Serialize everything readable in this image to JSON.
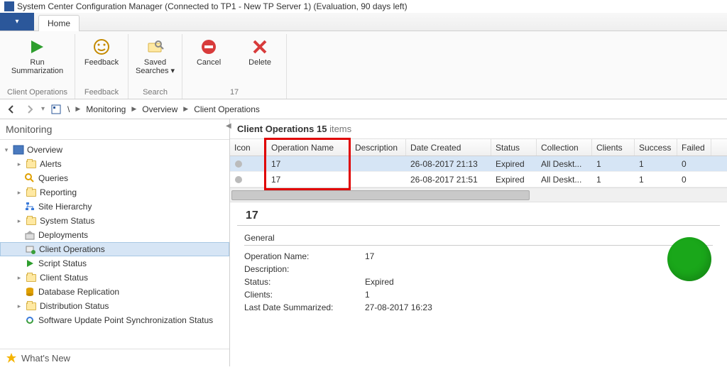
{
  "window": {
    "title": "System Center Configuration Manager (Connected to TP1 - New TP Server 1) (Evaluation, 90 days left)"
  },
  "tab": {
    "home": "Home"
  },
  "ribbon": {
    "run_summarization": "Run\nSummarization",
    "feedback": "Feedback",
    "saved_searches": "Saved\nSearches",
    "cancel": "Cancel",
    "delete": "Delete",
    "group_client_ops": "Client Operations",
    "group_feedback": "Feedback",
    "group_search": "Search",
    "group_17": "17"
  },
  "breadcrumb": {
    "root_sep": "\\",
    "monitoring": "Monitoring",
    "overview": "Overview",
    "client_ops": "Client Operations"
  },
  "tree": {
    "header": "Monitoring",
    "overview": "Overview",
    "alerts": "Alerts",
    "queries": "Queries",
    "reporting": "Reporting",
    "site_hierarchy": "Site Hierarchy",
    "system_status": "System Status",
    "deployments": "Deployments",
    "client_operations": "Client Operations",
    "script_status": "Script Status",
    "client_status": "Client Status",
    "database_replication": "Database Replication",
    "distribution_status": "Distribution Status",
    "software_update_point": "Software Update Point Synchronization Status",
    "whats_new": "What's New"
  },
  "list": {
    "title": "Client Operations",
    "count": "15",
    "items_word": "items",
    "columns": {
      "icon": "Icon",
      "operation_name": "Operation Name",
      "description": "Description",
      "date_created": "Date Created",
      "status": "Status",
      "collection": "Collection",
      "clients": "Clients",
      "success": "Success",
      "failed": "Failed"
    },
    "rows": [
      {
        "name": "17",
        "description": "",
        "date": "26-08-2017 21:13",
        "status": "Expired",
        "collection": "All Deskt...",
        "clients": "1",
        "success": "1",
        "failed": "0"
      },
      {
        "name": "17",
        "description": "",
        "date": "26-08-2017 21:51",
        "status": "Expired",
        "collection": "All Deskt...",
        "clients": "1",
        "success": "1",
        "failed": "0"
      }
    ]
  },
  "detail": {
    "heading": "17",
    "section": "General",
    "labels": {
      "operation_name": "Operation Name:",
      "description": "Description:",
      "status": "Status:",
      "clients": "Clients:",
      "last_summarized": "Last Date Summarized:"
    },
    "values": {
      "operation_name": "17",
      "description": "",
      "status": "Expired",
      "clients": "1",
      "last_summarized": "27-08-2017 16:23"
    }
  }
}
